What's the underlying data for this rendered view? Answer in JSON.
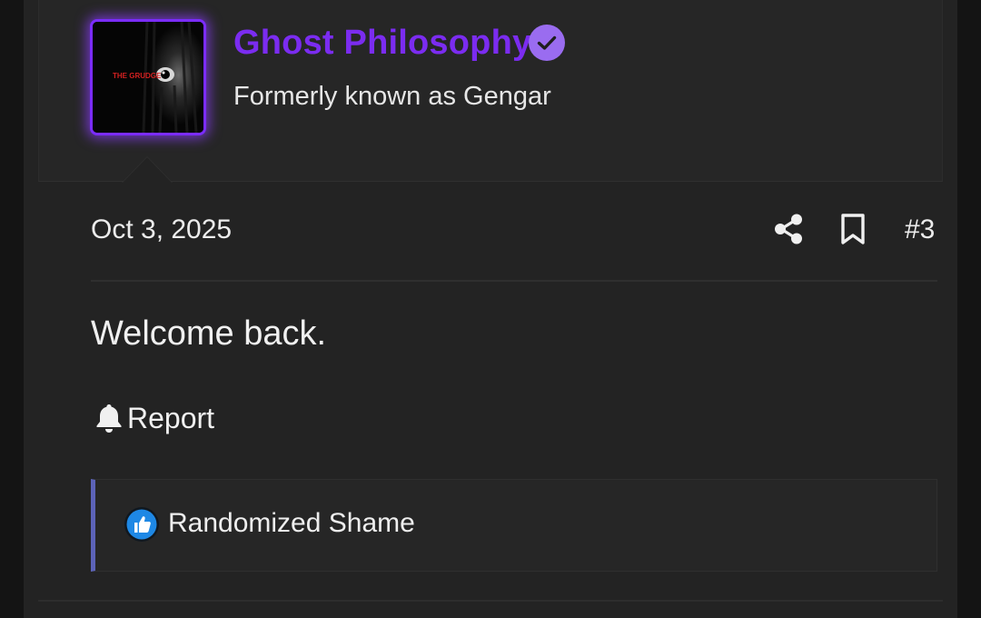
{
  "user": {
    "name": "Ghost Philosophy",
    "title": "Formerly known as Gengar",
    "avatar_text": "THE GRUDGE"
  },
  "post": {
    "date": "Oct 3, 2025",
    "number": "#3",
    "message": "Welcome back.",
    "report_label": "Report"
  },
  "reactions": {
    "text": "Randomized Shame"
  },
  "icons": {
    "verified": "verified-badge-icon",
    "share": "share-icon",
    "bookmark": "bookmark-icon",
    "report": "bell-icon",
    "reaction": "thumbs-up-icon"
  },
  "colors": {
    "username": "#7b2cf0",
    "avatar_glow": "#7b2cff",
    "verified_badge": "#9a6cf0",
    "reaction_accent": "#5c63b8",
    "like_blue": "#1e88e5"
  }
}
